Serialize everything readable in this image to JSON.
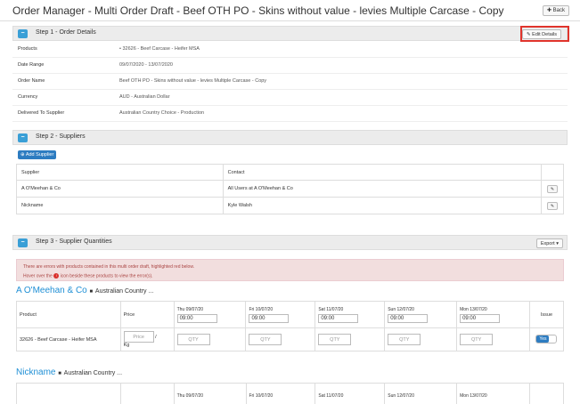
{
  "header": {
    "title": "Order Manager - Multi Order Draft - Beef OTH PO - Skins without value - levies Multiple Carcase - Copy",
    "back_label": "✚ Back"
  },
  "step1": {
    "title": "Step 1 - Order Details",
    "edit_label": "✎ Edit Details",
    "rows": [
      {
        "label": "Products",
        "value": "•  32626 - Beef Carcase - Heifer MSA"
      },
      {
        "label": "Date Range",
        "value": "09/07/2020 - 13/07/2020"
      },
      {
        "label": "Order Name",
        "value": "Beef OTH PO - Skins without value - levies Multiple Carcase - Copy"
      },
      {
        "label": "Currency",
        "value": "AUD - Australian Dollar"
      },
      {
        "label": "Delivered To Supplier",
        "value": "Australian Country Choice - Production"
      }
    ]
  },
  "step2": {
    "title": "Step 2 - Suppliers",
    "add_label": "⊕ Add Supplier",
    "columns": [
      "Supplier",
      "Contact"
    ],
    "rows": [
      {
        "supplier": "A O'Meehan & Co",
        "contact": "All Users at A O'Meehan & Co"
      },
      {
        "supplier": "Nickname",
        "contact": "Kyle Walsh"
      }
    ]
  },
  "step3": {
    "title": "Step 3 - Supplier Quantities",
    "export_label": "Export ▾",
    "alert_line1": "There are errors with products contained in this multi order draft, highlighted red below.",
    "alert_line2_pre": "Hover over the",
    "alert_line2_post": "icon beside these products to view the error(s).",
    "columns": {
      "product": "Product",
      "price": "Price",
      "issue": "Issue"
    },
    "days": [
      {
        "label": "Thu 09/07/20",
        "time": "09:00"
      },
      {
        "label": "Fri 10/07/20",
        "time": "09:00"
      },
      {
        "label": "Sat 11/07/20",
        "time": "09:00"
      },
      {
        "label": "Sun 12/07/20",
        "time": "09:00"
      },
      {
        "label": "Mon 13/07/20",
        "time": "09:00"
      }
    ],
    "qty_placeholder": "QTY",
    "price_placeholder": "Price",
    "price_unit_sep": "/",
    "price_unit": "Kg",
    "yes_label": "Yes",
    "groups": [
      {
        "name": "A O'Meehan & Co",
        "sub": "Australian Country ...",
        "product": "32626 - Beef Carcase - Heifer MSA"
      },
      {
        "name": "Nickname",
        "sub": "Australian Country ..."
      }
    ]
  }
}
